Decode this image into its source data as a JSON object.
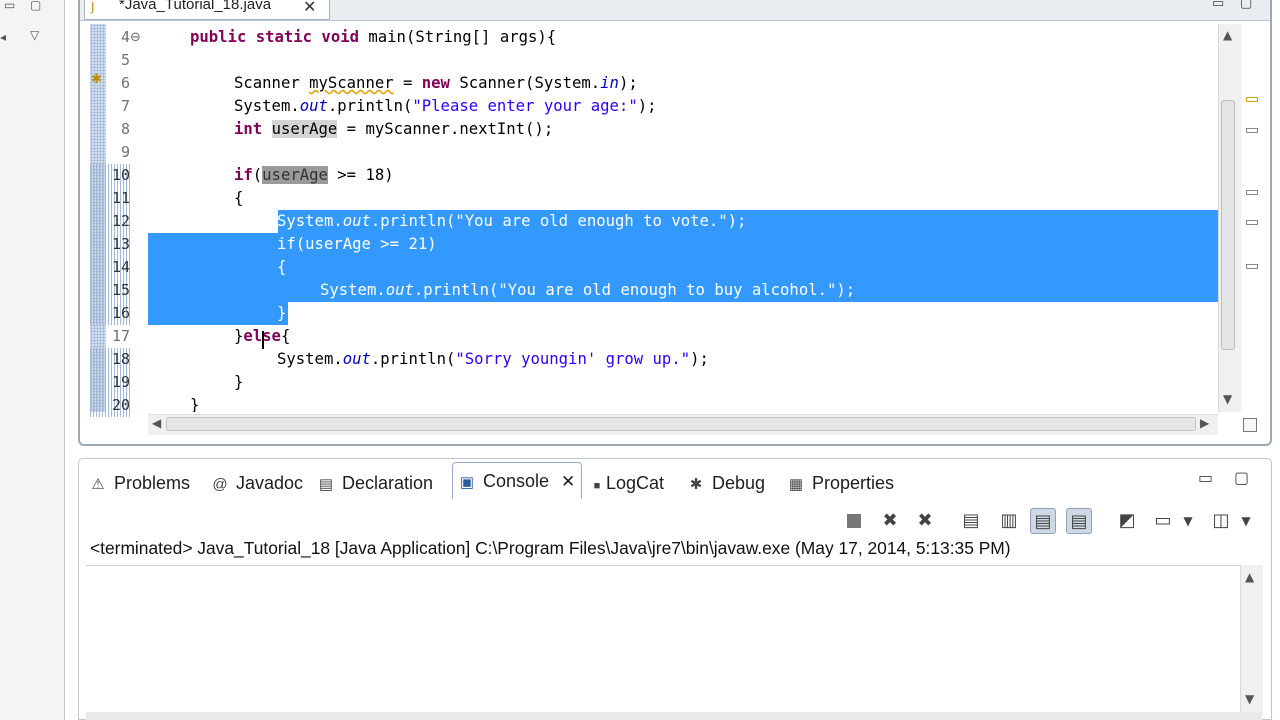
{
  "editor": {
    "tab_title": "*Java_Tutorial_18.java",
    "line_numbers": [
      "4",
      "5",
      "6",
      "7",
      "8",
      "9",
      "10",
      "11",
      "12",
      "13",
      "14",
      "15",
      "16",
      "17",
      "18",
      "19",
      "20"
    ],
    "fold_marker": "⊖"
  },
  "code": {
    "l4_a": "public static void ",
    "l4_b": "main(String[] args){",
    "l6_a": "Scanner ",
    "l6_b": "myScanner",
    "l6_c": " = ",
    "l6_d": "new",
    "l6_e": " Scanner(System.",
    "l6_f": "in",
    "l6_g": ");",
    "l7_a": "System.",
    "l7_b": "out",
    "l7_c": ".println(",
    "l7_d": "\"Please enter your age:\"",
    "l7_e": ");",
    "l8_a": "int",
    "l8_b": " ",
    "l8_c": "userAge",
    "l8_d": " = myScanner.nextInt();",
    "l10_a": "if",
    "l10_b": "(",
    "l10_c": "userAge",
    "l10_d": " >= 18)",
    "l11": "{",
    "l12_a": "System.",
    "l12_b": "out",
    "l12_c": ".println(",
    "l12_d": "\"You are old enough to vote.\"",
    "l12_e": ");",
    "l13_a": "if",
    "l13_b": "(userAge >= 21)",
    "l14": "{",
    "l15_a": "System.",
    "l15_b": "out",
    "l15_c": ".println(",
    "l15_d": "\"You are old enough to buy alcohol.\"",
    "l15_e": ");",
    "l16": "}",
    "l17_a": "}",
    "l17_b": "else",
    "l17_c": "{",
    "l18_a": "System.",
    "l18_b": "out",
    "l18_c": ".println(",
    "l18_d": "\"Sorry youngin' grow up.\"",
    "l18_e": ");",
    "l19": "}",
    "l20": "}"
  },
  "bottom_tabs": [
    {
      "label": "Problems",
      "icon": "problems-icon"
    },
    {
      "label": "Javadoc",
      "icon": "at-sign-icon",
      "glyph": "@"
    },
    {
      "label": "Declaration",
      "icon": "declaration-icon"
    },
    {
      "label": "Console",
      "icon": "console-icon",
      "active": true
    },
    {
      "label": "LogCat",
      "icon": "logcat-icon"
    },
    {
      "label": "Debug",
      "icon": "bug-icon"
    },
    {
      "label": "Properties",
      "icon": "properties-icon"
    }
  ],
  "close_glyph": "✕",
  "console": {
    "status": "<terminated> Java_Tutorial_18 [Java Application] C:\\Program Files\\Java\\jre7\\bin\\javaw.exe (May 17, 2014, 5:13:35 PM)"
  },
  "colors": {
    "selection": "#3399ff",
    "keyword": "#7f0055",
    "string": "#2a00ff",
    "field": "#0000c0"
  }
}
